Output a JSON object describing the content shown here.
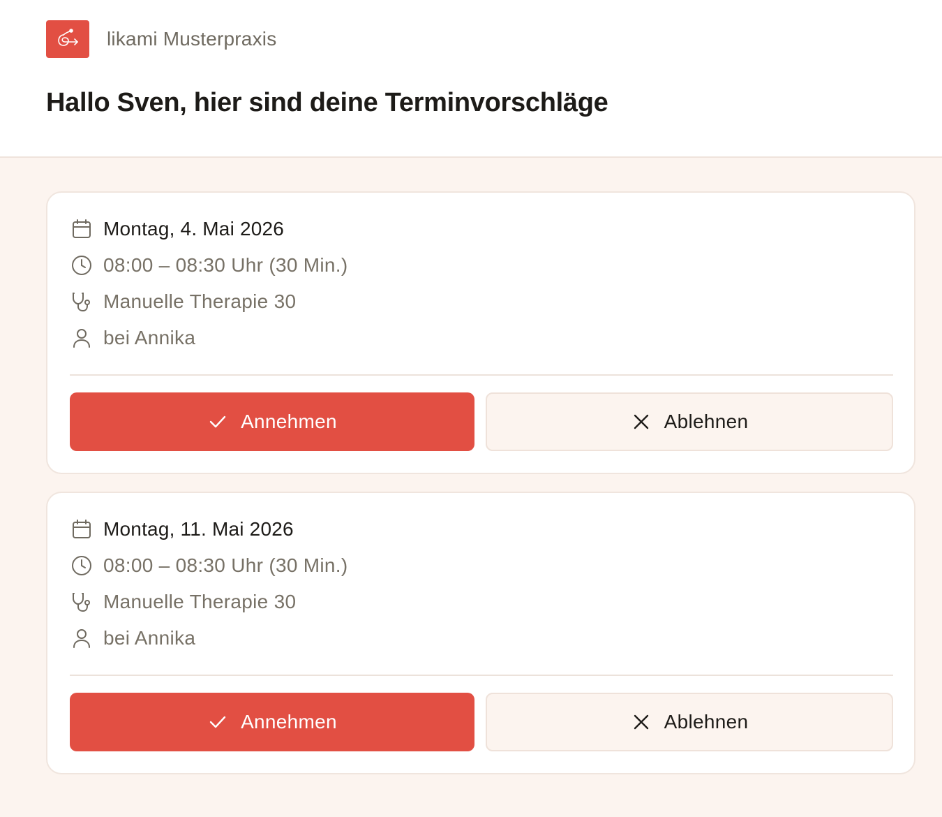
{
  "practice": {
    "name": "likami Musterpraxis",
    "logo_icon": "likami-logo-icon",
    "accent_color": "#e24f43"
  },
  "greeting": "Hallo Sven, hier sind deine Terminvorschläge",
  "appointments": [
    {
      "date": "Montag, 4. Mai 2026",
      "time": "08:00 – 08:30 Uhr (30 Min.)",
      "treatment": "Manuelle Therapie 30",
      "therapist": "bei Annika",
      "accept_label": "Annehmen",
      "decline_label": "Ablehnen"
    },
    {
      "date": "Montag, 11. Mai 2026",
      "time": "08:00 – 08:30 Uhr (30 Min.)",
      "treatment": "Manuelle Therapie 30",
      "therapist": "bei Annika",
      "accept_label": "Annehmen",
      "decline_label": "Ablehnen"
    }
  ],
  "icons": {
    "date": "calendar-icon",
    "time": "clock-icon",
    "treatment": "stethoscope-icon",
    "therapist": "user-icon",
    "accept": "check-icon",
    "decline": "close-icon"
  }
}
